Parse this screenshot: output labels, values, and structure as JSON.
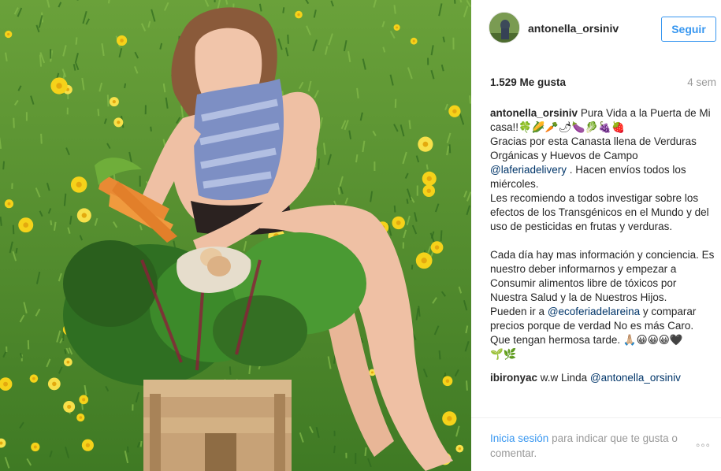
{
  "post": {
    "username": "antonella_orsiniv",
    "follow_label": "Seguir",
    "likes": "1.529 Me gusta",
    "age": "4 sem"
  },
  "caption": {
    "author": "antonella_orsiniv",
    "line1": "Pura Vida a la Puerta de Mi casa!!🍀🌽🥕🌶🍆🥬🍇🍓",
    "line2": "Gracias por esta Canasta llena de Verduras Orgánicas y Huevos de Campo",
    "mention1": "@laferiadelivery",
    "line3": ". Hacen envíos todos los miércoles.",
    "line4": "Les recomiendo a todos investigar sobre los efectos de los Transgénicos en el Mundo y del uso de pesticidas en frutas y verduras.",
    "line5": "Cada día hay mas información y conciencia. Es nuestro deber informarnos y empezar a Consumir alimentos libre de tóxicos por Nuestra Salud y la de Nuestros Hijos.",
    "line6a": "Pueden ir a",
    "mention2": "@ecoferiadelareina",
    "line6b": "y comparar precios porque de verdad No es más Caro.",
    "line7": "Que tengan hermosa tarde. 🙏🏼😀😀😀🖤",
    "line8": "🌱🌿"
  },
  "comment2": {
    "author": "ibironyac",
    "text_before": "w.w Linda",
    "mention": "@antonella_orsiniv"
  },
  "footer": {
    "login_link": "Inicia sesión",
    "login_rest": "para indicar que te gusta o comentar.",
    "more_icon": "◦◦◦"
  },
  "colors": {
    "accent": "#3897f0",
    "mention": "#003569",
    "muted": "#999999",
    "grass": "#4e8a2e",
    "flower": "#f5d21a"
  }
}
